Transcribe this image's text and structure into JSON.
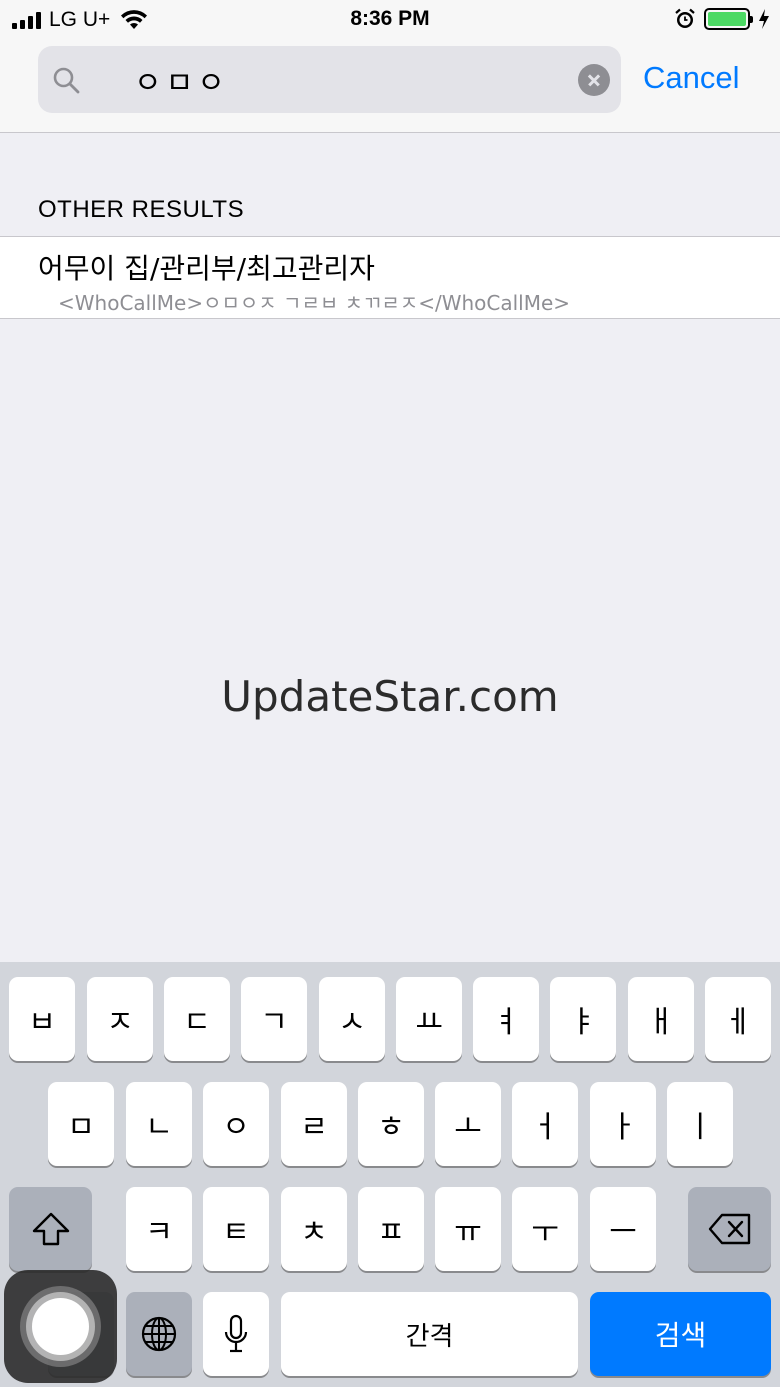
{
  "status_bar": {
    "carrier": "LG U+",
    "time": "8:36 PM",
    "battery_color": "#4cd964"
  },
  "search": {
    "query": "ㅇㅁㅇ",
    "cancel_label": "Cancel",
    "icon": "search-icon",
    "clear_icon": "clear-icon"
  },
  "results": {
    "section_header": "OTHER RESULTS",
    "items": [
      {
        "title": "어무이 집/관리부/최고관리자",
        "subtitle": "<WhoCallMe>ㅇㅁㅇㅈ ㄱㄹㅂ ㅊㄲㄹㅈ</WhoCallMe>"
      }
    ]
  },
  "watermark": "UpdateStar.com",
  "keyboard": {
    "row1": [
      "ㅂ",
      "ㅈ",
      "ㄷ",
      "ㄱ",
      "ㅅ",
      "ㅛ",
      "ㅕ",
      "ㅑ",
      "ㅐ",
      "ㅔ"
    ],
    "row2": [
      "ㅁ",
      "ㄴ",
      "ㅇ",
      "ㄹ",
      "ㅎ",
      "ㅗ",
      "ㅓ",
      "ㅏ",
      "ㅣ"
    ],
    "row3": [
      "ㅋ",
      "ㅌ",
      "ㅊ",
      "ㅍ",
      "ㅠ",
      "ㅜ",
      "ㅡ"
    ],
    "space_label": "간격",
    "search_label": "검색",
    "accent_color": "#007aff"
  }
}
